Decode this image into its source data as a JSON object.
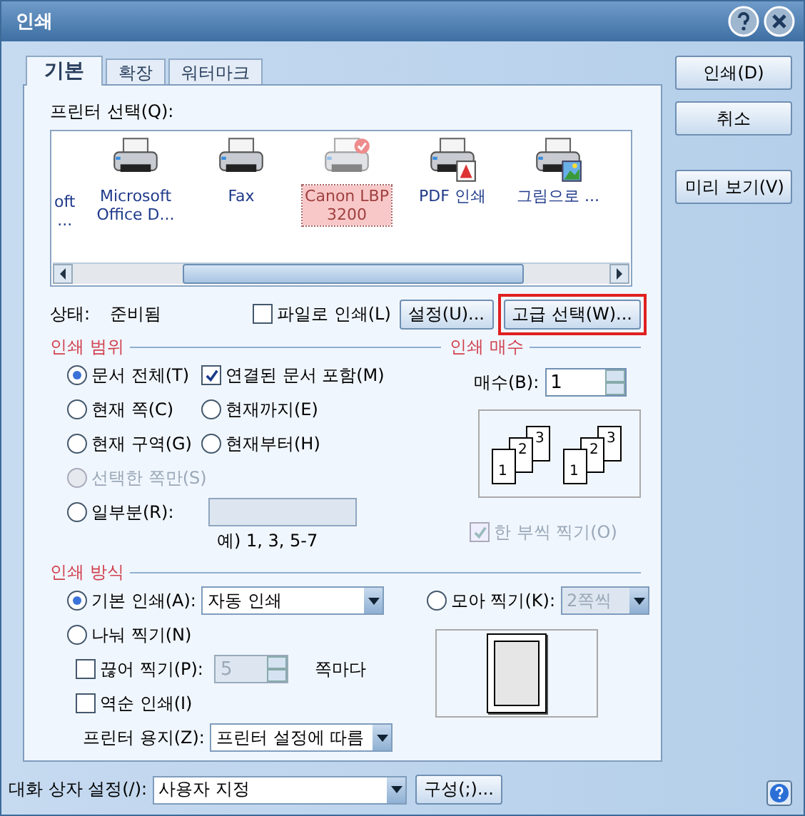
{
  "window": {
    "title": "인쇄"
  },
  "tabs": [
    {
      "label": "기본",
      "selected": true
    },
    {
      "label": "확장",
      "selected": false
    },
    {
      "label": "워터마크",
      "selected": false
    }
  ],
  "printer_select": {
    "label": "프린터 선택(Q):",
    "printers": [
      {
        "name": "oft\n...",
        "kind": "cut",
        "selected": false
      },
      {
        "name": "Microsoft\nOffice D...",
        "kind": "plain",
        "selected": false
      },
      {
        "name": "Fax",
        "kind": "plain",
        "selected": false
      },
      {
        "name": "Canon LBP\n3200",
        "kind": "default",
        "selected": true
      },
      {
        "name": "PDF 인쇄",
        "kind": "pdf",
        "selected": false
      },
      {
        "name": "그림으로 ...",
        "kind": "image",
        "selected": false
      }
    ]
  },
  "status": {
    "label": "상태:",
    "value": "준비됨"
  },
  "print_to_file": {
    "label": "파일로 인쇄(L)",
    "checked": false
  },
  "buttons_row": [
    {
      "label": "설정(U)...",
      "highlighted": false
    },
    {
      "label": "고급 선택(W)...",
      "highlighted": true
    }
  ],
  "print_range": {
    "title": "인쇄 범위",
    "rows": [
      [
        {
          "kind": "radio",
          "label": "문서 전체(T)",
          "selected": true,
          "disabled": false
        },
        {
          "kind": "checkbox",
          "label": "연결된 문서 포함(M)",
          "checked": true,
          "disabled": false
        }
      ],
      [
        {
          "kind": "radio",
          "label": "현재 쪽(C)",
          "selected": false,
          "disabled": false
        },
        {
          "kind": "radio",
          "label": "현재까지(E)",
          "selected": false,
          "disabled": false
        }
      ],
      [
        {
          "kind": "radio",
          "label": "현재 구역(G)",
          "selected": false,
          "disabled": false
        },
        {
          "kind": "radio",
          "label": "현재부터(H)",
          "selected": false,
          "disabled": false
        }
      ],
      [
        {
          "kind": "radio",
          "label": "선택한 쪽만(S)",
          "selected": false,
          "disabled": true
        }
      ],
      [
        {
          "kind": "radio",
          "label": "일부분(R):",
          "selected": false,
          "disabled": false
        },
        {
          "kind": "field",
          "disabled": true
        }
      ]
    ],
    "hint": "예) 1, 3, 5-7"
  },
  "copies": {
    "title": "인쇄 매수",
    "label": "매수(B):",
    "value": "1",
    "pages": [
      [
        "1",
        "2",
        "3"
      ],
      [
        "1",
        "2",
        "3"
      ]
    ],
    "collate": {
      "label": "한 부씩 찍기(O)",
      "checked": true,
      "disabled": true
    }
  },
  "print_method": {
    "title": "인쇄 방식",
    "normal": {
      "label": "기본 인쇄(A):",
      "selected": true,
      "value": "자동 인쇄"
    },
    "nup": {
      "label": "모아 찍기(K):",
      "selected": false,
      "value": "2쪽씩",
      "disabled": true
    },
    "split": {
      "label": "나눠 찍기(N)",
      "selected": false
    },
    "chunk": {
      "label": "끊어 찍기(P):",
      "checked": false,
      "value": "5",
      "disabled": true,
      "suffix": "쪽마다"
    },
    "reverse": {
      "label": "역순 인쇄(I)",
      "checked": false
    },
    "paper": {
      "label": "프린터 용지(Z):",
      "value": "프린터 설정에 따름"
    }
  },
  "dialog_settings": {
    "label": "대화 상자 설정(/):",
    "value": "사용자 지정",
    "button": "구성(;)..."
  },
  "side_buttons": [
    {
      "label": "인쇄(D)"
    },
    {
      "label": "취소"
    },
    {
      "label": "미리 보기(V)"
    }
  ]
}
